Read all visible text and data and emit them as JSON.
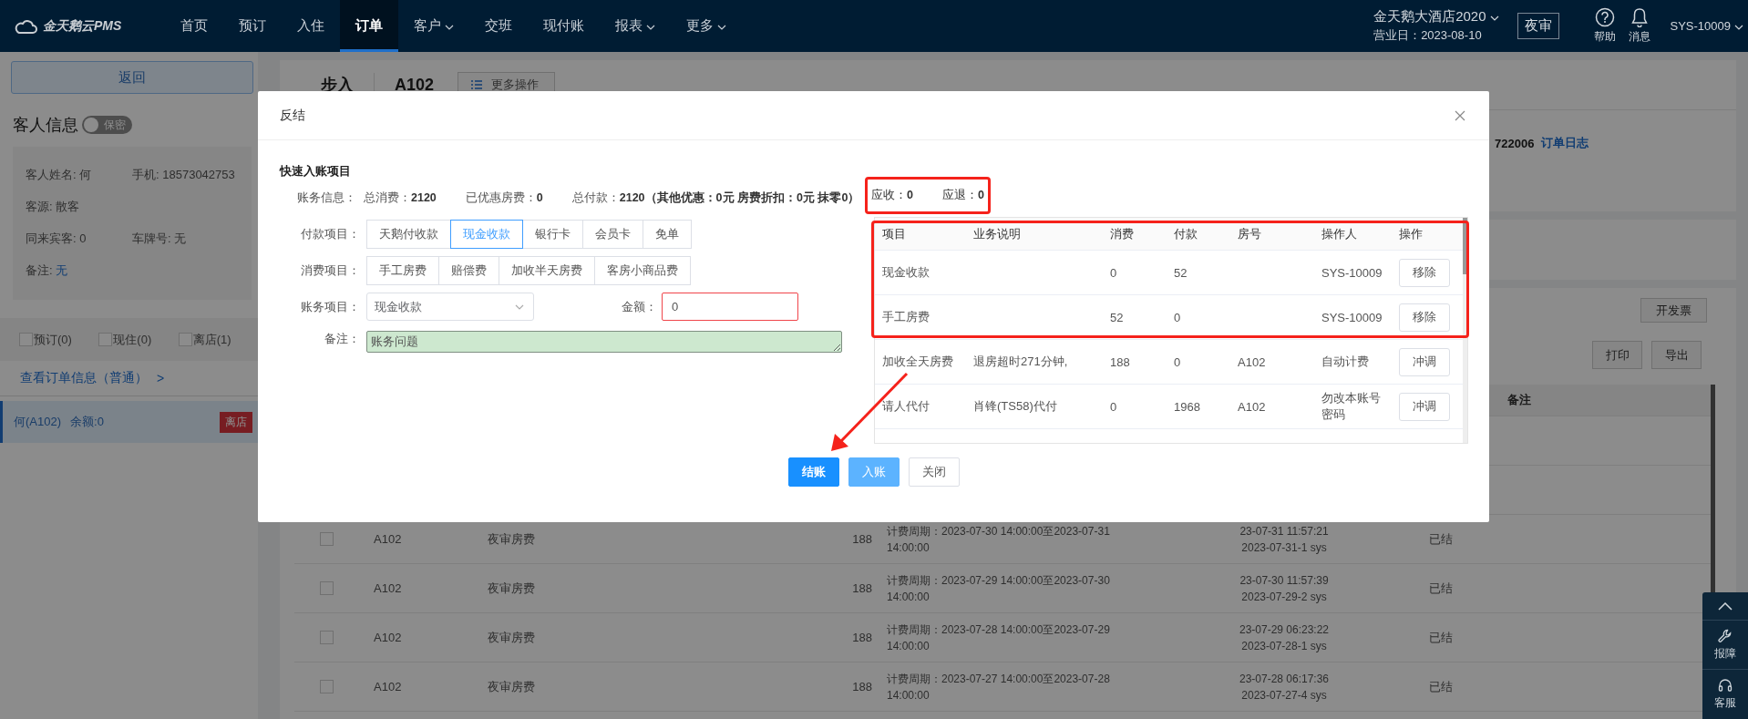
{
  "nav": {
    "logo": "金天鹅云PMS",
    "items": [
      {
        "label": "首页",
        "selected": false,
        "has_menu": false
      },
      {
        "label": "预订",
        "selected": false,
        "has_menu": false
      },
      {
        "label": "入住",
        "selected": false,
        "has_menu": false
      },
      {
        "label": "订单",
        "selected": true,
        "has_menu": false
      },
      {
        "label": "客户",
        "selected": false,
        "has_menu": true
      },
      {
        "label": "交班",
        "selected": false,
        "has_menu": false
      },
      {
        "label": "现付账",
        "selected": false,
        "has_menu": false
      },
      {
        "label": "报表",
        "selected": false,
        "has_menu": true
      },
      {
        "label": "更多",
        "selected": false,
        "has_menu": true
      }
    ],
    "hotel": "金天鹅大酒店2020",
    "business_day": "营业日：2023-08-10",
    "night_audit": "夜审",
    "help": "帮助",
    "messages": "消息",
    "user": "SYS-10009"
  },
  "guest_panel": {
    "back": "返回",
    "title": "客人信息",
    "privacy_toggle": {
      "label": "保密",
      "on": false
    },
    "rows": [
      [
        {
          "label": "客人姓名: ",
          "value": "何",
          "kind": "text"
        },
        {
          "label": "手机: ",
          "value": "18573042753",
          "kind": "text"
        }
      ],
      [
        {
          "label": "客源: ",
          "value": "散客",
          "kind": "text"
        }
      ],
      [
        {
          "label": "同来宾客: ",
          "value": "0",
          "kind": "text"
        },
        {
          "label": "车牌号: ",
          "value": "无",
          "kind": "text"
        }
      ],
      [
        {
          "label": "备注: ",
          "value": "无",
          "kind": "link"
        }
      ]
    ],
    "filters": [
      {
        "label": "预订(0)",
        "checked": false
      },
      {
        "label": "现住(0)",
        "checked": false
      },
      {
        "label": "离店(1)",
        "checked": false
      }
    ],
    "order_link": "查看订单信息（普通）",
    "order_link_chevron": ">",
    "stays": [
      {
        "label": "何(A102)",
        "balance": "余额:0",
        "status": "离店",
        "selected": true
      }
    ]
  },
  "main": {
    "order_type": "步入",
    "room": "A102",
    "more_actions": "更多操作",
    "order_no": "722006",
    "order_log": "订单日志",
    "invoice": "开发票",
    "print": "打印",
    "export": "导出",
    "columns": [
      {
        "label": "备注"
      }
    ],
    "rows": [
      {
        "checked": false,
        "room": "A102",
        "item": "夜审房费",
        "amount": "188",
        "period": "计费周期：2023-07-30 14:00:00至2023-07-31 14:00:00",
        "time": "23-07-31 11:57:21",
        "ref": "2023-07-31-1 sys",
        "status": "已结"
      },
      {
        "checked": false,
        "room": "A102",
        "item": "夜审房费",
        "amount": "188",
        "period": "计费周期：2023-07-29 14:00:00至2023-07-30 14:00:00",
        "time": "23-07-30 11:57:39",
        "ref": "2023-07-29-2 sys",
        "status": "已结"
      },
      {
        "checked": false,
        "room": "A102",
        "item": "夜审房费",
        "amount": "188",
        "period": "计费周期：2023-07-28 14:00:00至2023-07-29 14:00:00",
        "time": "23-07-29 06:23:22",
        "ref": "2023-07-28-1 sys",
        "status": "已结"
      },
      {
        "checked": false,
        "room": "A102",
        "item": "夜审房费",
        "amount": "188",
        "period": "计费周期：2023-07-27 14:00:00至2023-07-28 14:00:00",
        "time": "23-07-28 06:17:36",
        "ref": "2023-07-27-4 sys",
        "status": "已结"
      }
    ]
  },
  "dialog": {
    "title": "反结",
    "section_title": "快速入账项目",
    "account_info": {
      "label": "账务信息：",
      "items": [
        "总消费：**2120**",
        "已优惠房费：**0**",
        "总付款：**2120（其他优惠：0元 房费折扣：0元 抹零0）**"
      ]
    },
    "balance": {
      "highlighted": true,
      "items": [
        "应收：**0**",
        "应退：**0**"
      ]
    },
    "payment": {
      "label": "付款项目：",
      "options": [
        {
          "label": "天鹅付收款",
          "selected": false
        },
        {
          "label": "现金收款",
          "selected": true
        },
        {
          "label": "银行卡",
          "selected": false
        },
        {
          "label": "会员卡",
          "selected": false
        },
        {
          "label": "免单",
          "selected": false
        }
      ]
    },
    "charge": {
      "label": "消费项目：",
      "options": [
        {
          "label": "手工房费",
          "selected": false
        },
        {
          "label": "赔偿费",
          "selected": false
        },
        {
          "label": "加收半天房费",
          "selected": false
        },
        {
          "label": "客房小商品费",
          "selected": false
        }
      ]
    },
    "account_item": {
      "label": "账务项目：",
      "value": "现金收款"
    },
    "amount": {
      "label": "金额：",
      "value": "0",
      "invalid": true
    },
    "remark": {
      "label": "备注：",
      "value": "账务问题"
    },
    "ledger": {
      "columns": [
        "项目",
        "业务说明",
        "消费",
        "付款",
        "房号",
        "操作人",
        "操作"
      ],
      "rows": [
        {
          "item": "现金收款",
          "consumption": "0",
          "payment": "52",
          "operator": "SYS-10009",
          "action": "移除",
          "highlighted": true
        },
        {
          "item": "手工房费",
          "consumption": "52",
          "payment": "0",
          "operator": "SYS-10009",
          "action": "移除",
          "highlighted": true
        },
        {
          "item": "加收全天房费",
          "description": "退房超时271分钟,",
          "consumption": "188",
          "payment": "0",
          "room": "A102",
          "operator": "自动计费",
          "action": "冲调",
          "highlighted": false
        },
        {
          "item": "请人代付",
          "description": "肖锋(TS58)代付",
          "consumption": "0",
          "payment": "1968",
          "room": "A102",
          "operator": "勿改本账号密码",
          "action": "冲调",
          "highlighted": false
        }
      ]
    },
    "buttons": [
      {
        "label": "结账",
        "kind": "primary"
      },
      {
        "label": "入账",
        "kind": "secondary"
      },
      {
        "label": "关闭",
        "kind": "default"
      }
    ],
    "annotation_arrow": true
  },
  "dock": {
    "items": [
      {
        "kind": "top"
      },
      {
        "kind": "repair",
        "label": "报障"
      },
      {
        "kind": "service",
        "label": "客服"
      }
    ]
  }
}
